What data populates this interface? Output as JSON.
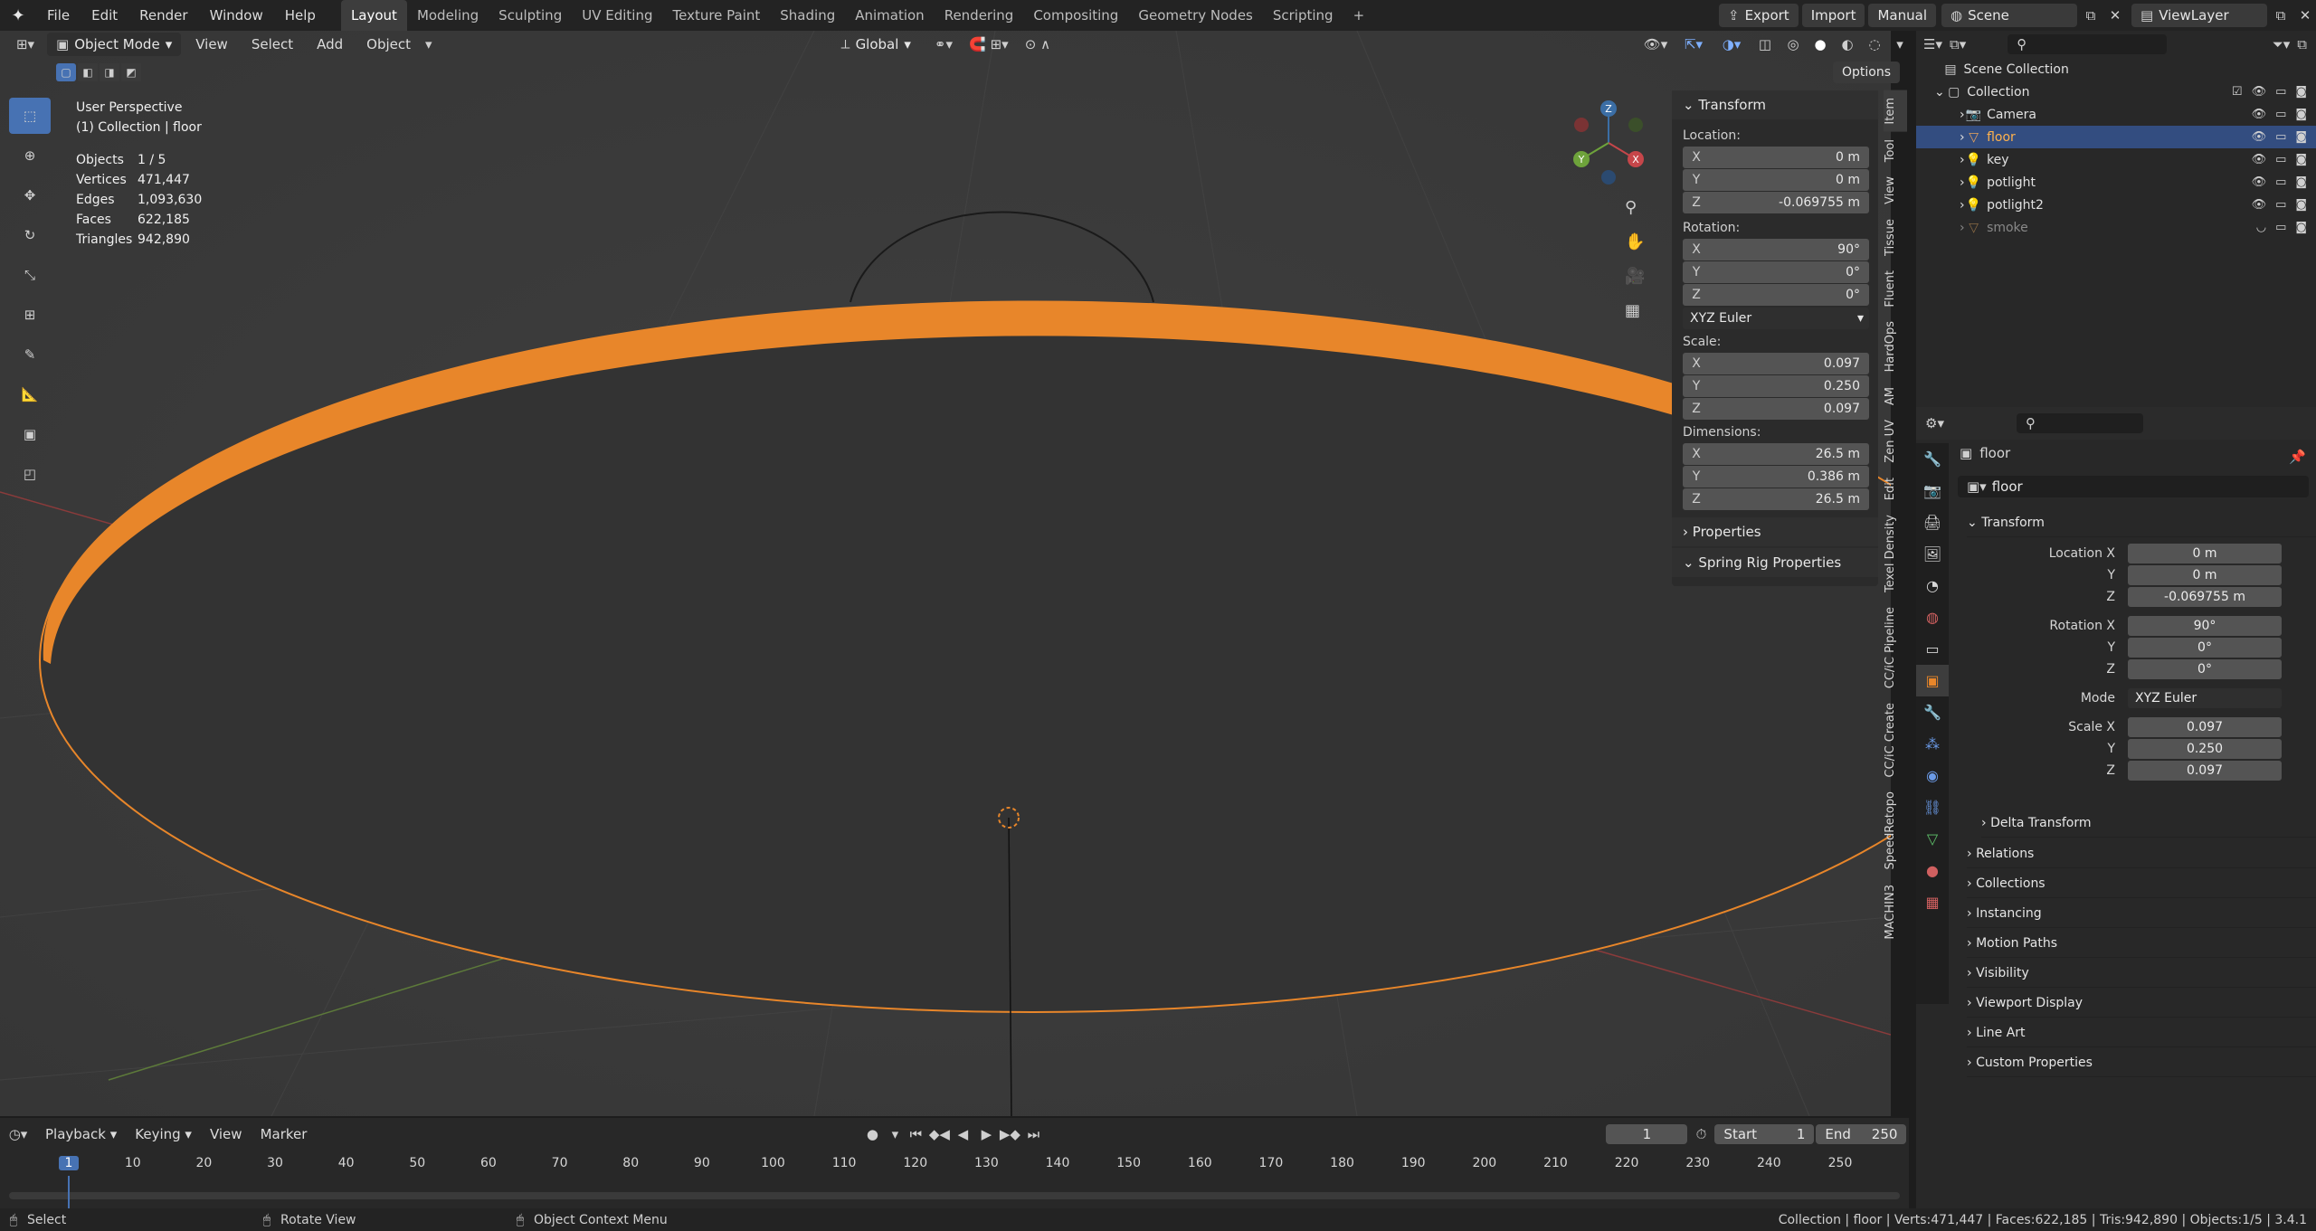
{
  "menu": [
    "File",
    "Edit",
    "Render",
    "Window",
    "Help"
  ],
  "workspaces": [
    "Layout",
    "Modeling",
    "Sculpting",
    "UV Editing",
    "Texture Paint",
    "Shading",
    "Animation",
    "Rendering",
    "Compositing",
    "Geometry Nodes",
    "Scripting"
  ],
  "header_right": {
    "export": "Export",
    "import": "Import",
    "manual": "Manual",
    "scene": "Scene",
    "view_layer": "ViewLayer"
  },
  "viewport_header": {
    "mode": "Object Mode",
    "view": "View",
    "select": "Select",
    "add": "Add",
    "object": "Object",
    "orientation": "Global",
    "options": "Options"
  },
  "overlay": {
    "title": "User Perspective",
    "subtitle": "(1) Collection | floor",
    "stats": [
      {
        "label": "Objects",
        "value": "1 / 5"
      },
      {
        "label": "Vertices",
        "value": "471,447"
      },
      {
        "label": "Edges",
        "value": "1,093,630"
      },
      {
        "label": "Faces",
        "value": "622,185"
      },
      {
        "label": "Triangles",
        "value": "942,890"
      }
    ]
  },
  "npanel": {
    "header": "Transform",
    "location_label": "Location:",
    "location": [
      {
        "ax": "X",
        "v": "0 m"
      },
      {
        "ax": "Y",
        "v": "0 m"
      },
      {
        "ax": "Z",
        "v": "-0.069755 m"
      }
    ],
    "rotation_label": "Rotation:",
    "rotation": [
      {
        "ax": "X",
        "v": "90°"
      },
      {
        "ax": "Y",
        "v": "0°"
      },
      {
        "ax": "Z",
        "v": "0°"
      }
    ],
    "rotation_mode": "XYZ Euler",
    "scale_label": "Scale:",
    "scale": [
      {
        "ax": "X",
        "v": "0.097"
      },
      {
        "ax": "Y",
        "v": "0.250"
      },
      {
        "ax": "Z",
        "v": "0.097"
      }
    ],
    "dimensions_label": "Dimensions:",
    "dimensions": [
      {
        "ax": "X",
        "v": "26.5 m"
      },
      {
        "ax": "Y",
        "v": "0.386 m"
      },
      {
        "ax": "Z",
        "v": "26.5 m"
      }
    ],
    "properties": "Properties",
    "spring": "Spring Rig Properties"
  },
  "vtabs": [
    "Item",
    "Tool",
    "View",
    "Tissue",
    "Fluent",
    "HardOps",
    "AM",
    "Zen UV",
    "Edit",
    "Texel Density",
    "CC/iC Pipeline",
    "CC/iC Create",
    "SpeedRetopo",
    "MACHIN3"
  ],
  "outliner": {
    "scene_collection": "Scene Collection",
    "collection": "Collection",
    "items": [
      {
        "name": "Camera",
        "selected": false
      },
      {
        "name": "floor",
        "selected": true
      },
      {
        "name": "key",
        "selected": false
      },
      {
        "name": "potlight",
        "selected": false
      },
      {
        "name": "potlight2",
        "selected": false
      },
      {
        "name": "smoke",
        "selected": false
      }
    ]
  },
  "properties": {
    "object_name": "floor",
    "datablock": "floor",
    "transform": "Transform",
    "rows": [
      {
        "l": "Location X",
        "v": "0 m"
      },
      {
        "l": "Y",
        "v": "0 m"
      },
      {
        "l": "Z",
        "v": "-0.069755 m"
      },
      {
        "l": "Rotation X",
        "v": "90°"
      },
      {
        "l": "Y",
        "v": "0°"
      },
      {
        "l": "Z",
        "v": "0°"
      },
      {
        "l": "Mode",
        "v": "XYZ Euler"
      },
      {
        "l": "Scale X",
        "v": "0.097"
      },
      {
        "l": "Y",
        "v": "0.250"
      },
      {
        "l": "Z",
        "v": "0.097"
      }
    ],
    "delta": "Delta Transform",
    "sections": [
      "Relations",
      "Collections",
      "Instancing",
      "Motion Paths",
      "Visibility",
      "Viewport Display",
      "Line Art",
      "Custom Properties"
    ]
  },
  "timeline": {
    "menus": [
      "Playback",
      "Keying",
      "View",
      "Marker"
    ],
    "current_frame": "1",
    "start_label": "Start",
    "start": "1",
    "end_label": "End",
    "end": "250",
    "ticks": [
      "1",
      "10",
      "20",
      "30",
      "40",
      "50",
      "60",
      "70",
      "80",
      "90",
      "100",
      "110",
      "120",
      "130",
      "140",
      "150",
      "160",
      "170",
      "180",
      "190",
      "200",
      "210",
      "220",
      "230",
      "240",
      "250"
    ]
  },
  "status": {
    "select": "Select",
    "rotate": "Rotate View",
    "context": "Object Context Menu",
    "info": "Collection | floor | Verts:471,447 | Faces:622,185 | Tris:942,890 | Objects:1/5 | 3.4.1"
  },
  "colors": {
    "accent": "#4772b3",
    "orange": "#e8862a",
    "selected_row": "#334d80"
  }
}
